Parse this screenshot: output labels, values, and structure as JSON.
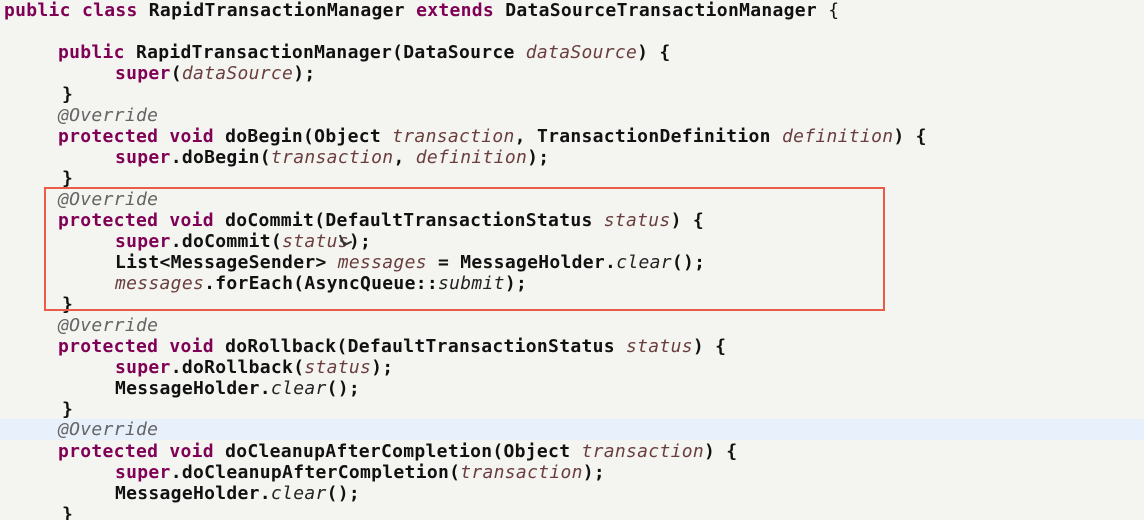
{
  "code": {
    "class_decl": {
      "kw_public": "public",
      "kw_class": "class",
      "class_name": "RapidTransactionManager",
      "kw_extends": "extends",
      "super_class": "DataSourceTransactionManager",
      "brace": "{"
    },
    "constructor": {
      "kw_public": "public",
      "name": "RapidTransactionManager",
      "sig_open": "(DataSource ",
      "param": "dataSource",
      "sig_close": ") {",
      "super_kw": "super",
      "super_open": "(",
      "super_arg": "dataSource",
      "super_close": ");",
      "end": "}"
    },
    "do_begin": {
      "annotation": "@Override",
      "kw_protected": "protected",
      "kw_void": "void",
      "name": "doBegin",
      "open": "(Object ",
      "param1": "transaction",
      "mid": ", TransactionDefinition ",
      "param2": "definition",
      "close": ") {",
      "super_kw": "super",
      "call": ".doBegin(",
      "arg1": "transaction",
      "comma": ", ",
      "arg2": "definition",
      "call_close": ");",
      "end": "}"
    },
    "do_commit": {
      "annotation": "@Override",
      "kw_protected": "protected",
      "kw_void": "void",
      "name": "doCommit",
      "open": "(DefaultTransactionStatus ",
      "param": "status",
      "close": ") {",
      "super_kw": "super",
      "call": ".doCommit(",
      "arg": "status",
      "call_close": ");",
      "decl_type": "List<MessageSender> ",
      "decl_var": "messages",
      "decl_assign": " = MessageHolder.",
      "decl_method": "clear",
      "decl_end": "();",
      "foreach_var": "messages",
      "foreach_call": ".forEach(AsyncQueue::",
      "foreach_ref": "submit",
      "foreach_end": ");",
      "end": "}"
    },
    "do_rollback": {
      "annotation": "@Override",
      "kw_protected": "protected",
      "kw_void": "void",
      "name": "doRollback",
      "open": "(DefaultTransactionStatus ",
      "param": "status",
      "close": ") {",
      "super_kw": "super",
      "call": ".doRollback(",
      "arg": "status",
      "call_close": ");",
      "holder": "MessageHolder.",
      "holder_method": "clear",
      "holder_end": "();",
      "end": "}"
    },
    "do_cleanup": {
      "annotation": "@Override",
      "kw_protected": "protected",
      "kw_void": "void",
      "name": "doCleanupAfterCompletion",
      "open": "(Object ",
      "param": "transaction",
      "close": ") {",
      "super_kw": "super",
      "call": ".doCleanupAfterCompletion(",
      "arg": "transaction",
      "call_close": ");",
      "holder": "MessageHolder.",
      "holder_method": "clear",
      "holder_end": "();",
      "end": "}"
    }
  },
  "colors": {
    "background": "#f4f4f0",
    "keyword": "#7f0055",
    "parameter": "#6a3e3e",
    "annotation": "#646464",
    "highlight_border": "#ea5b48",
    "current_line": "#e8f0fb"
  }
}
